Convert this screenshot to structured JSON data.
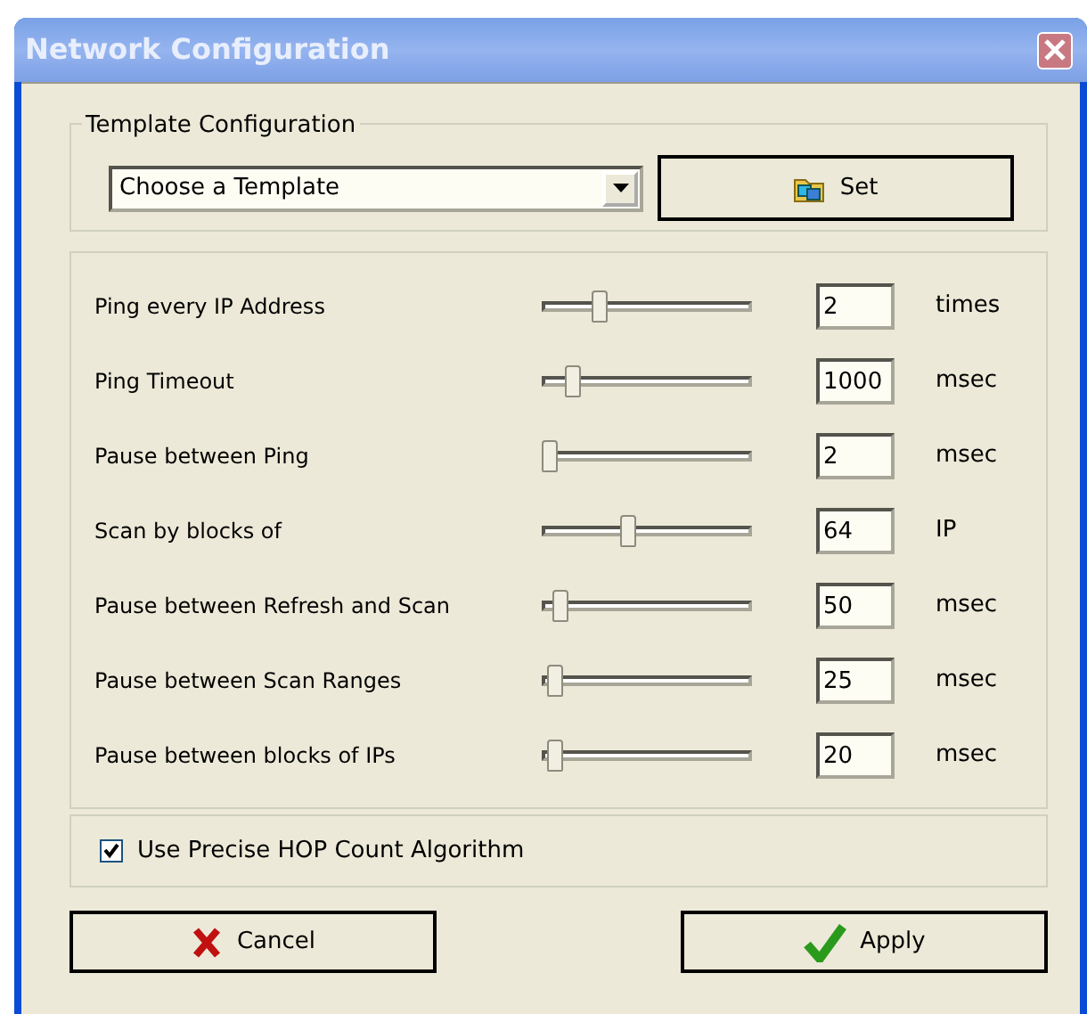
{
  "window": {
    "title": "Network Configuration"
  },
  "template": {
    "legend": "Template Configuration",
    "dropdown": "Choose a Template",
    "set_button": "Set"
  },
  "settings": [
    {
      "label": "Ping every IP Address",
      "level": 0.27,
      "value": "2",
      "unit": "times"
    },
    {
      "label": "Ping Timeout",
      "level": 0.12,
      "value": "1000",
      "unit": "msec"
    },
    {
      "label": "Pause between Ping",
      "level": 0.0,
      "value": "2",
      "unit": "msec"
    },
    {
      "label": "Scan by blocks of",
      "level": 0.42,
      "value": "64",
      "unit": "IP"
    },
    {
      "label": "Pause between Refresh and Scan",
      "level": 0.06,
      "value": "50",
      "unit": "msec"
    },
    {
      "label": "Pause between Scan Ranges",
      "level": 0.03,
      "value": "25",
      "unit": "msec"
    },
    {
      "label": "Pause between blocks of IPs",
      "level": 0.03,
      "value": "20",
      "unit": "msec"
    }
  ],
  "precise_hop": {
    "label": "Use Precise HOP Count Algorithm",
    "checked": true
  },
  "buttons": [
    {
      "label": "Cancel",
      "kind": "cancel"
    },
    {
      "label": "Apply",
      "kind": "apply"
    }
  ]
}
